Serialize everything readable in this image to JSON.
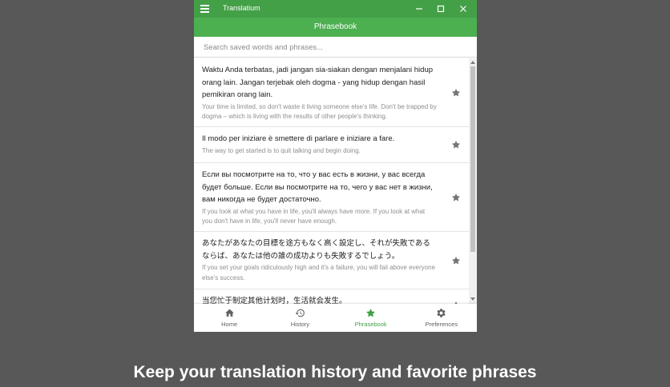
{
  "window": {
    "app_title": "Translatium",
    "page_title": "Phrasebook"
  },
  "search": {
    "placeholder": "Search saved words and phrases..."
  },
  "phrases": [
    {
      "source": "Waktu Anda terbatas, jadi jangan sia-siakan dengan menjalani hidup orang lain. Jangan terjebak oleh dogma - yang hidup dengan hasil pemikiran orang lain.",
      "translation": "Your time is limited, so don't waste it living someone else's life. Don't be trapped by dogma – which is living with the results of other people's thinking."
    },
    {
      "source": "Il modo per iniziare è smettere di parlare e iniziare a fare.",
      "translation": "The way to get started is to quit talking and begin doing."
    },
    {
      "source": "Если вы посмотрите на то, что у вас есть в жизни, у вас всегда будет больше. Если вы посмотрите на то, чего у вас нет в жизни, вам никогда не будет достаточно.",
      "translation": "If you look at what you have in life, you'll always have more. If you look at what you don't have in life, you'll never have enough."
    },
    {
      "source": "あなたがあなたの目標を途方もなく高く設定し、それが失敗であるならば、あなたは他の誰の成功よりも失敗するでしょう。",
      "translation": "If you set your goals ridiculously high and it's a failure, you will fail above everyone else's success."
    },
    {
      "source": "当您忙于制定其他计划时，生活就会发生。",
      "translation": ""
    }
  ],
  "bottom_nav": {
    "home": "Home",
    "history": "History",
    "phrasebook": "Phrasebook",
    "preferences": "Preferences"
  },
  "caption": "Keep your translation history and favorite phrases",
  "colors": {
    "titlebar": "#43a047",
    "appbar": "#4caf50",
    "accent": "#43a047",
    "backdrop": "#585858"
  }
}
